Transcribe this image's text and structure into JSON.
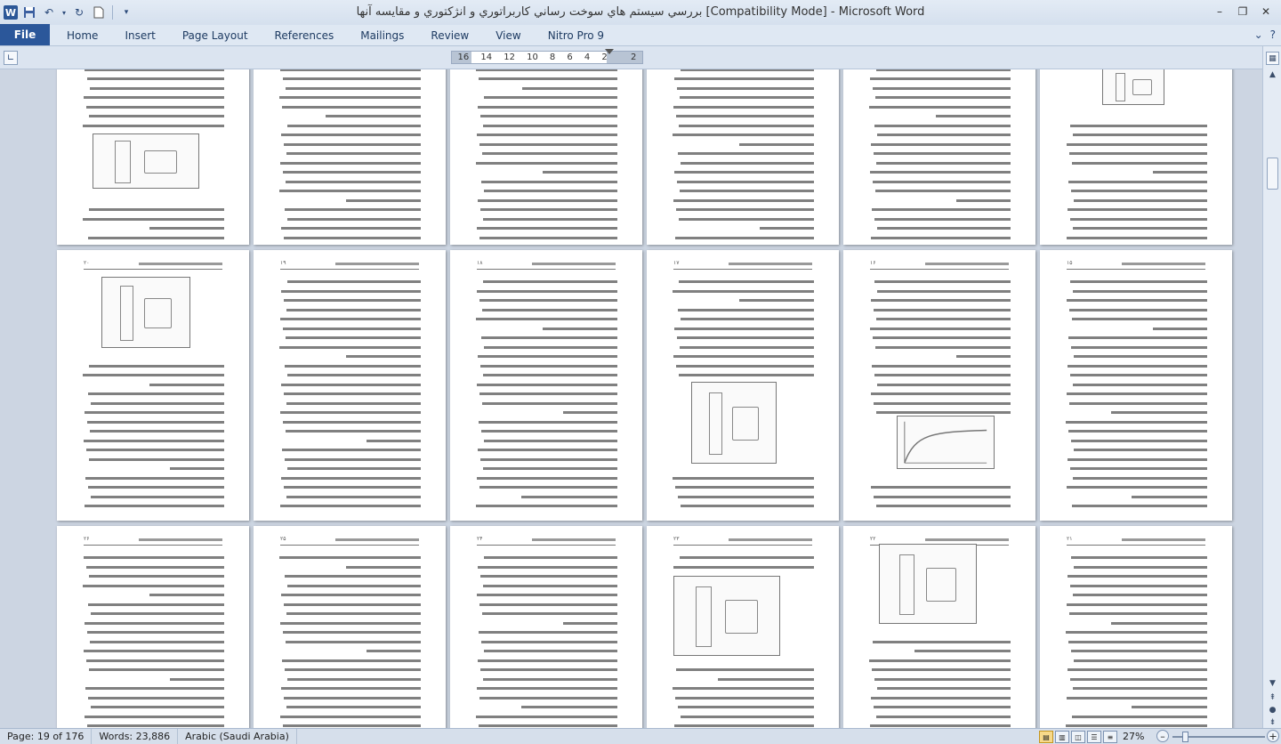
{
  "window": {
    "title": "بررسي سيستم هاي سوخت رساني كاربراتوري و انژكتوري و مقايسه آنها [Compatibility Mode]  -  Microsoft Word",
    "app_icon": "W",
    "controls": [
      "–",
      "❐",
      "✕"
    ]
  },
  "qat": [
    "save-icon",
    "undo-icon",
    "redo-icon",
    "new-document-icon",
    "customize-icon"
  ],
  "ribbon": {
    "file_label": "File",
    "tabs": [
      "Home",
      "Insert",
      "Page Layout",
      "References",
      "Mailings",
      "Review",
      "View",
      "Nitro Pro 9"
    ],
    "help": "?"
  },
  "ruler": {
    "marks": [
      "16",
      "14",
      "12",
      "10",
      "8",
      "6",
      "4",
      "2",
      "",
      "2"
    ]
  },
  "status": {
    "page": "Page: 19 of 176",
    "words": "Words: 23,886",
    "language": "Arabic (Saudi Arabia)",
    "zoom": "27%",
    "zoom_level": 27
  },
  "pages": {
    "row2_numbers": [
      "۲۰",
      "۱۹",
      "۱۸",
      "۱۷",
      "۱۶",
      "۱۵"
    ],
    "row3_numbers": [
      "۲۶",
      "۲۵",
      "۲۴",
      "۲۳",
      "۲۲",
      "۲۱"
    ]
  },
  "colors": {
    "file_tab": "#2b579a",
    "background": "#ccd5e2"
  }
}
